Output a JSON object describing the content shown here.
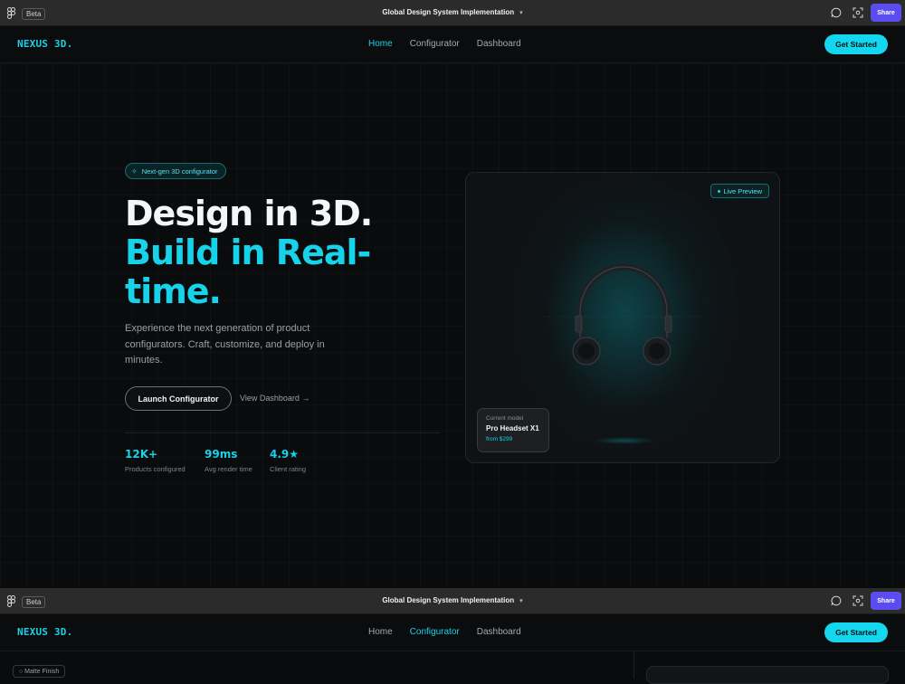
{
  "figma": {
    "beta": "Beta",
    "file_title": "Global Design System Implementation",
    "share": "Share"
  },
  "nav_top": {
    "brand": "NEXUS 3D.",
    "links": [
      "Home",
      "Configurator",
      "Dashboard"
    ],
    "active": "Home",
    "cta": "Get Started"
  },
  "hero": {
    "badge": "Next-gen 3D configurator",
    "title_line1": "Design in 3D.",
    "title_line2": "Build in Real-",
    "title_line3": "time.",
    "lead": "Experience the next generation of product configurators. Craft, customize, and deploy in minutes.",
    "primary_button": "Launch Configurator",
    "secondary_link": "View Dashboard →",
    "stats": [
      {
        "value": "12K+",
        "label": "Products configured"
      },
      {
        "value": "99ms",
        "label": "Avg render time"
      },
      {
        "value": "4.9★",
        "label": "Client rating"
      }
    ]
  },
  "preview": {
    "live_label": "Live Preview",
    "model_caption": "Current model",
    "model_name": "Pro Headset X1",
    "model_price": "from $299"
  },
  "nav_bottom": {
    "brand": "NEXUS 3D.",
    "links": [
      "Home",
      "Configurator",
      "Dashboard"
    ],
    "active": "Configurator",
    "cta": "Get Started"
  },
  "configurator_peek": {
    "finish_chip": "○ Matte Finish"
  },
  "colors": {
    "accent": "#16d3ea",
    "figma_share": "#5b4cf0",
    "background": "#0a0b0c"
  }
}
